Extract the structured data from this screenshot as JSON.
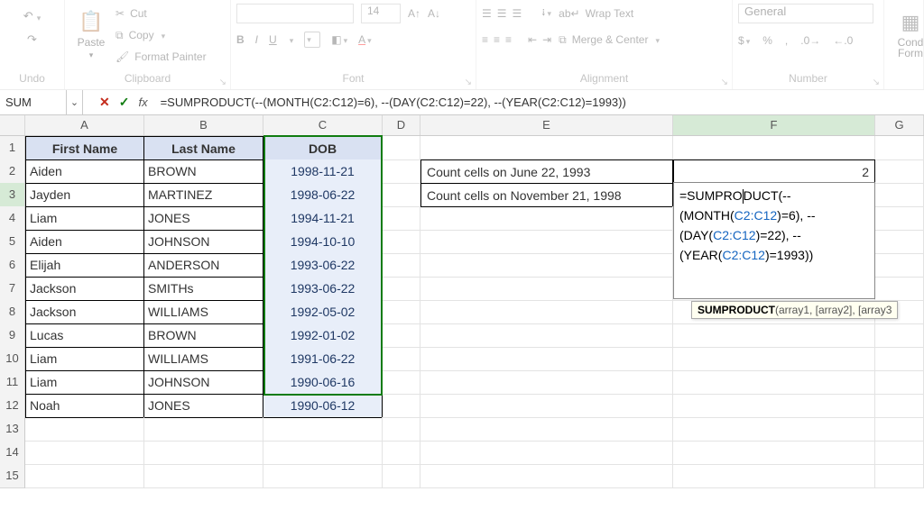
{
  "ribbon": {
    "undo_label": "Undo",
    "clipboard": {
      "paste": "Paste",
      "cut": "Cut",
      "copy": "Copy",
      "fmt": "Format Painter",
      "label": "Clipboard"
    },
    "font": {
      "label": "Font",
      "name": "",
      "size": "14",
      "bold": "B",
      "italic": "I",
      "underline": "U"
    },
    "alignment": {
      "label": "Alignment",
      "wrap": "Wrap Text",
      "merge": "Merge & Center"
    },
    "number": {
      "label": "Number",
      "format": "General"
    },
    "cond": "Cond\nForm"
  },
  "formula_bar": {
    "name_box": "SUM",
    "formula": "=SUMPRODUCT(--(MONTH(C2:C12)=6), --(DAY(C2:C12)=22), --(YEAR(C2:C12)=1993))"
  },
  "columns": [
    "",
    "A",
    "B",
    "C",
    "D",
    "E",
    "F",
    "G"
  ],
  "row_labels": [
    "1",
    "2",
    "3",
    "4",
    "5",
    "6",
    "7",
    "8",
    "9",
    "10",
    "11",
    "12",
    "13",
    "14",
    "15"
  ],
  "table": {
    "headers": [
      "First Name",
      "Last Name",
      "DOB"
    ],
    "rows": [
      [
        "Aiden",
        "BROWN",
        "1998-11-21"
      ],
      [
        "Jayden",
        "MARTINEZ",
        "1998-06-22"
      ],
      [
        "Liam",
        "JONES",
        "1994-11-21"
      ],
      [
        "Aiden",
        "JOHNSON",
        "1994-10-10"
      ],
      [
        "Elijah",
        "ANDERSON",
        "1993-06-22"
      ],
      [
        "Jackson",
        "SMITHs",
        "1993-06-22"
      ],
      [
        "Jackson",
        "WILLIAMS",
        "1992-05-02"
      ],
      [
        "Lucas",
        "BROWN",
        "1992-01-02"
      ],
      [
        "Liam",
        "WILLIAMS",
        "1991-06-22"
      ],
      [
        "Liam",
        "JOHNSON",
        "1990-06-16"
      ],
      [
        "Noah",
        "JONES",
        "1990-06-12"
      ]
    ]
  },
  "side": {
    "e2": "Count cells on June 22, 1993",
    "e3": "Count cells on November 21, 1998",
    "f2": "2"
  },
  "edit_formula": {
    "parts": [
      {
        "t": "=SUMPRO",
        "c": "c-black"
      },
      {
        "t": "|",
        "cursor": true
      },
      {
        "t": "DUCT",
        "c": "c-black"
      },
      {
        "t": "(--(",
        "c": "c-black"
      },
      {
        "t": "MONTH",
        "c": "c-black"
      },
      {
        "t": "(",
        "c": "c-black"
      },
      {
        "t": "C2:C12",
        "c": "c-blue"
      },
      {
        "t": ")",
        "c": "c-black"
      },
      {
        "t": "=6), --(",
        "c": "c-black"
      },
      {
        "t": "DAY",
        "c": "c-black"
      },
      {
        "t": "(",
        "c": "c-black"
      },
      {
        "t": "C2:C12",
        "c": "c-blue"
      },
      {
        "t": ")",
        "c": "c-black"
      },
      {
        "t": "=22), --(",
        "c": "c-black"
      },
      {
        "t": "YEAR",
        "c": "c-black"
      },
      {
        "t": "(",
        "c": "c-black"
      },
      {
        "t": "C2:C12",
        "c": "c-blue"
      },
      {
        "t": ")",
        "c": "c-black"
      },
      {
        "t": "=1993",
        "c": "c-black"
      },
      {
        "t": ")",
        "c": "c-black"
      },
      {
        "t": ")",
        "c": "c-black"
      }
    ]
  },
  "tooltip": {
    "func": "SUMPRODUCT",
    "sig": "(array1, [array2], [array3"
  }
}
